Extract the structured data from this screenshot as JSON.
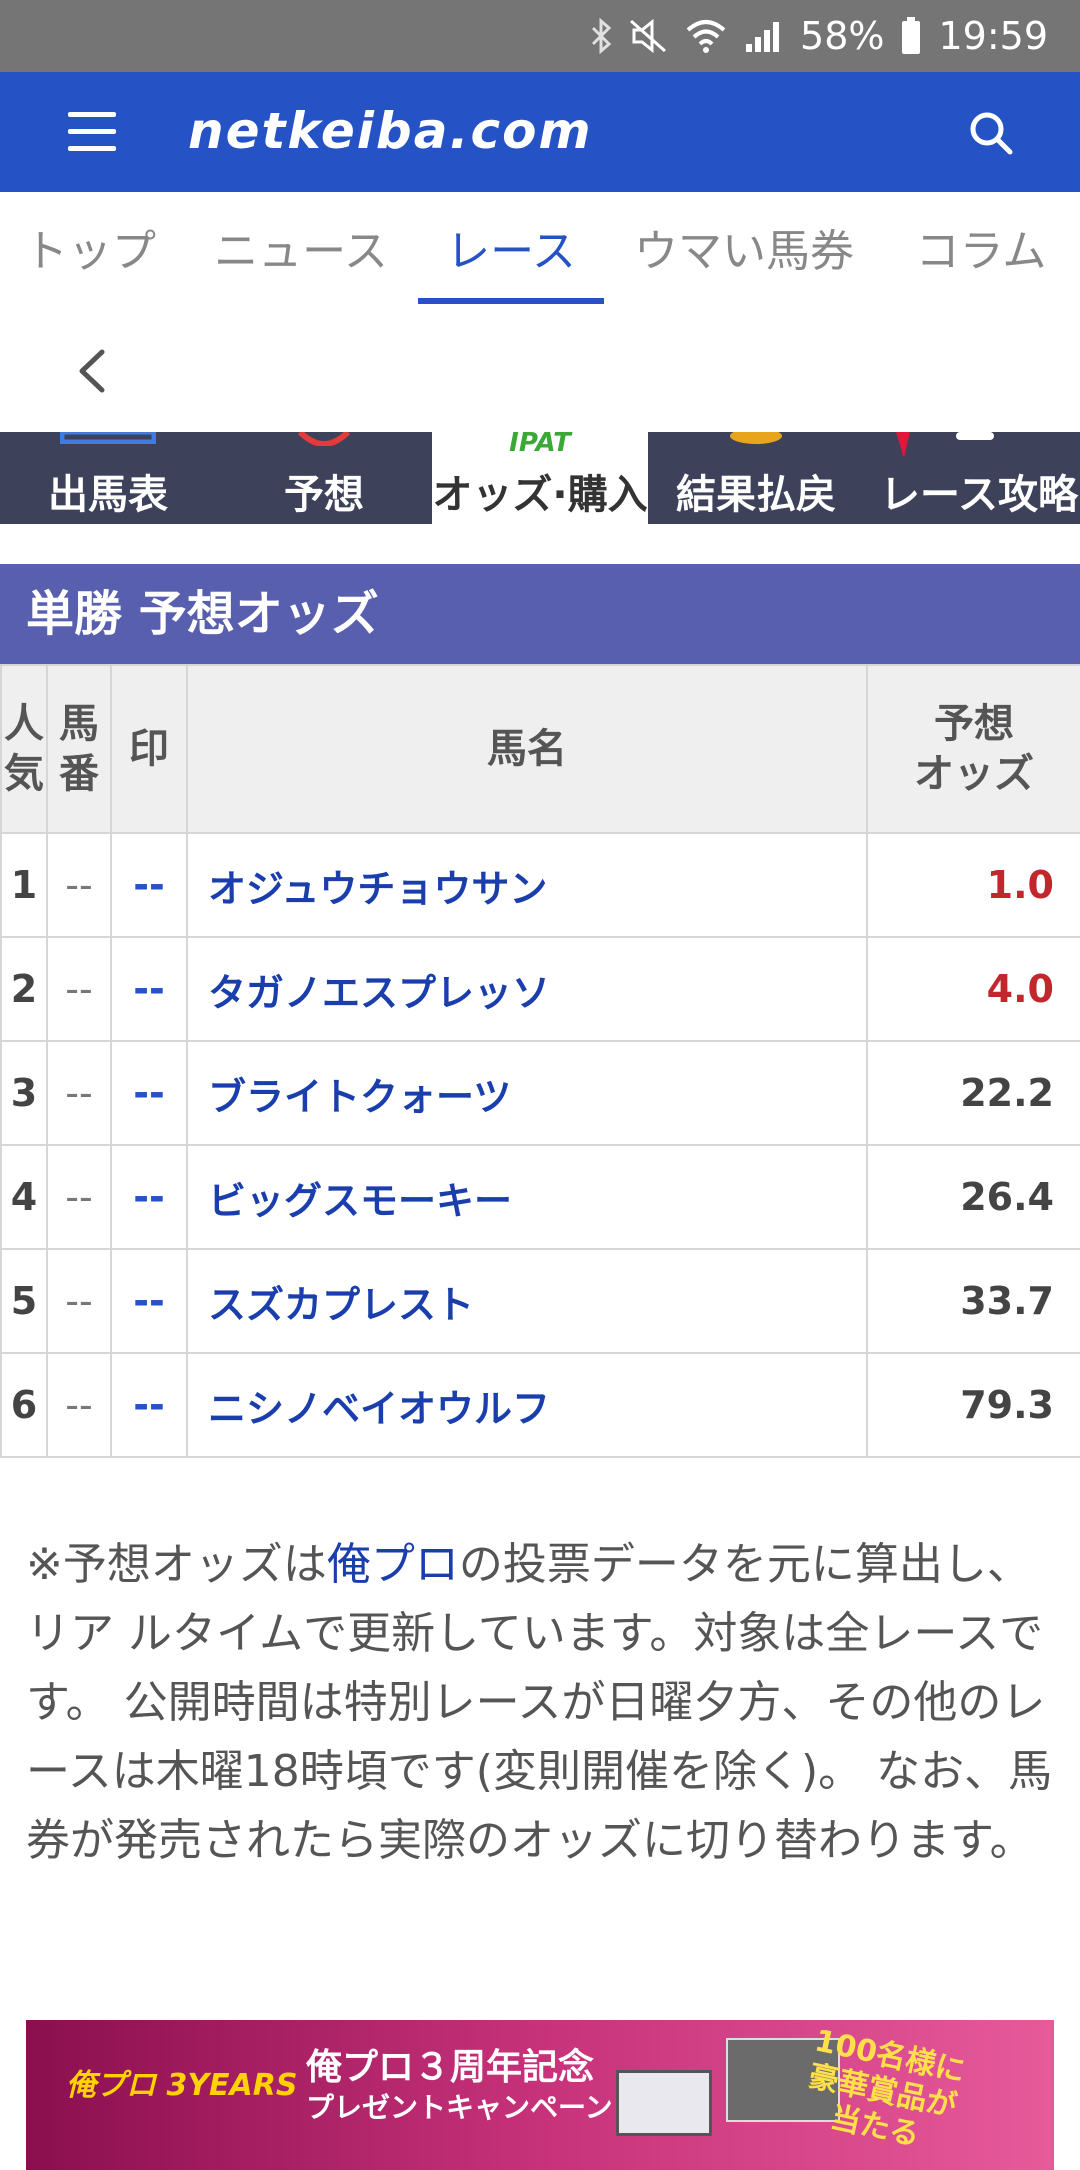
{
  "status_bar": {
    "battery": "58%",
    "time": "19:59",
    "icons": [
      "bluetooth-icon",
      "mute-icon",
      "wifi-icon",
      "signal-icon",
      "battery-icon"
    ]
  },
  "header": {
    "logo": "netkeiba.com",
    "menu_icon": "hamburger-menu-icon",
    "search_icon": "search-icon",
    "background_color": "#2553c6"
  },
  "nav_tabs": [
    {
      "label": "トップ"
    },
    {
      "label": "ニュース"
    },
    {
      "label": "レース"
    },
    {
      "label": "ウマい馬券"
    },
    {
      "label": "コラム"
    }
  ],
  "nav_active": "レース",
  "back_icon": "chevron-left-icon",
  "sub_tabs": [
    {
      "label": "出馬表"
    },
    {
      "label": "予想"
    },
    {
      "label": "オッズ·購入",
      "badge": "IPAT"
    },
    {
      "label": "結果払戻"
    },
    {
      "label": "レース攻略"
    }
  ],
  "sub_active": "オッズ·購入",
  "section": {
    "title": "単勝 予想オッズ"
  },
  "table": {
    "headers": {
      "rank": "人\n気",
      "num": "馬\n番",
      "mark": "印",
      "name": "馬名",
      "odds": "予想\nオッズ"
    },
    "rows": [
      {
        "rank": "1",
        "num": "--",
        "mark": "--",
        "name": "オジュウチョウサン",
        "odds": "1.0"
      },
      {
        "rank": "2",
        "num": "--",
        "mark": "--",
        "name": "タガノエスプレッソ",
        "odds": "4.0"
      },
      {
        "rank": "3",
        "num": "--",
        "mark": "--",
        "name": "ブライトクォーツ",
        "odds": "22.2"
      },
      {
        "rank": "4",
        "num": "--",
        "mark": "--",
        "name": "ビッグスモーキー",
        "odds": "26.4"
      },
      {
        "rank": "5",
        "num": "--",
        "mark": "--",
        "name": "スズカプレスト",
        "odds": "33.7"
      },
      {
        "rank": "6",
        "num": "--",
        "mark": "--",
        "name": "ニシノベイオウルフ",
        "odds": "79.3"
      }
    ],
    "hot_color": "#c1272d"
  },
  "note": {
    "prefix": "※予想オッズは",
    "link": "俺プロ",
    "suffix": "の投票データを元に算出し、リア ルタイムで更新しています。対象は全レースです。 公開時間は特別レースが日曜夕方、その他のレースは木曜18時頃です(変則開催を除く)。 なお、馬券が発売されたら実際のオッズに切り替わります。"
  },
  "banner": {
    "logo": "俺プロ 3YEARS",
    "title": "俺プロ３周年記念",
    "subtitle": "プレゼントキャンペーン",
    "prize": "100名様に\n豪華賞品が\n当たる"
  }
}
